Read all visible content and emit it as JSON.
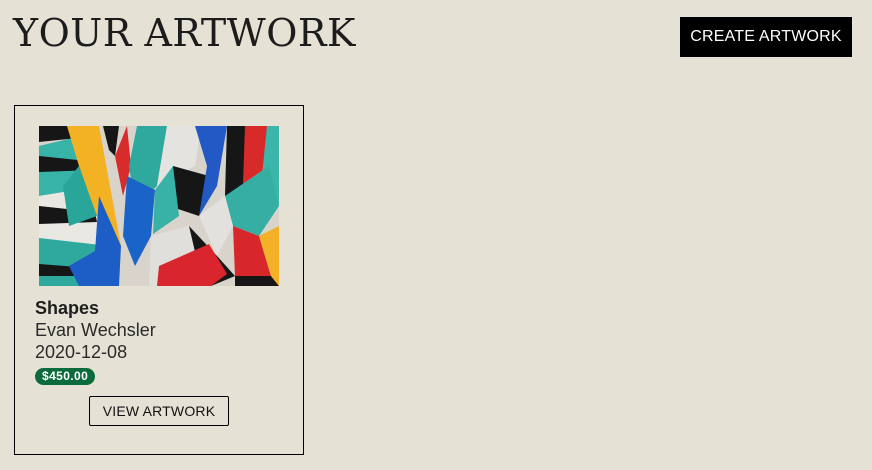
{
  "header": {
    "title": "YOUR ARTWORK",
    "create_button_label": "CREATE ARTWORK"
  },
  "artworks": [
    {
      "title": "Shapes",
      "artist": "Evan Wechsler",
      "date": "2020-12-08",
      "price": "$450.00",
      "view_button_label": "VIEW ARTWORK",
      "image": "abstract colorful shapes painting"
    }
  ],
  "colors": {
    "background": "#e5e1d5",
    "button_primary": "#000000",
    "price_badge": "#0c6b3c"
  }
}
